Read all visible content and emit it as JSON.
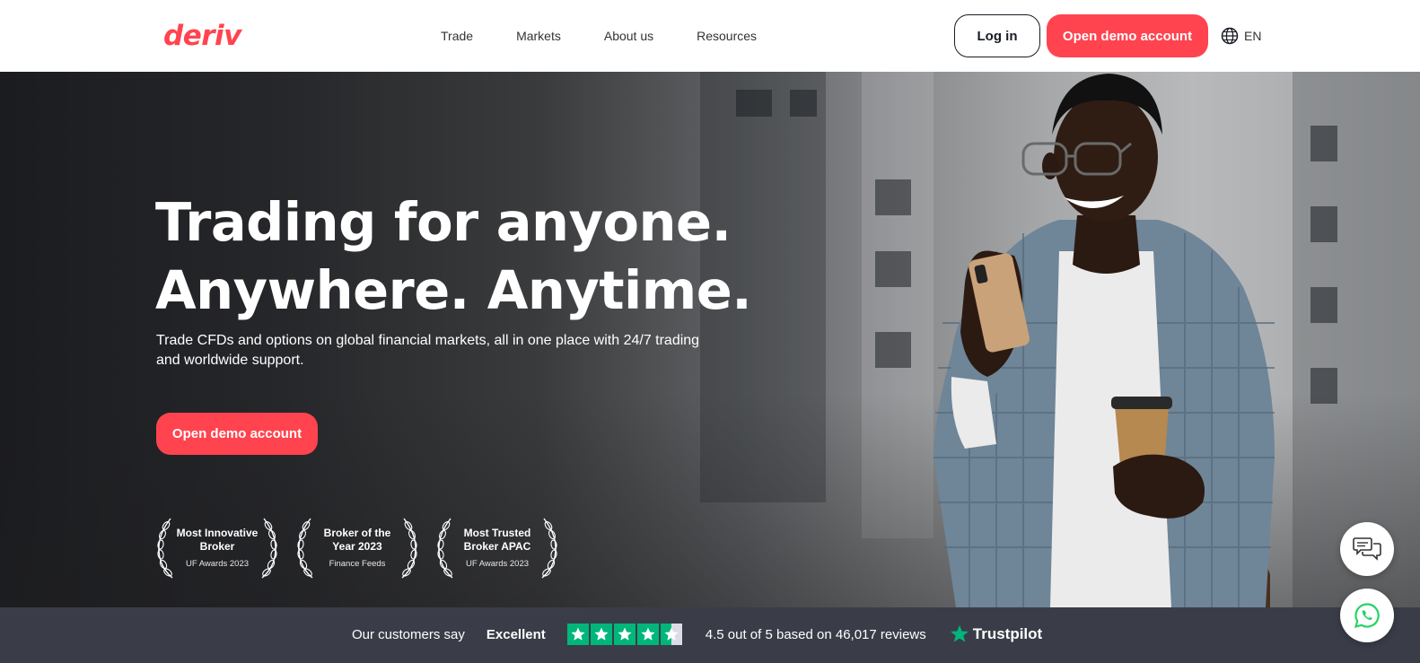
{
  "header": {
    "logo": "deriv",
    "nav": [
      "Trade",
      "Markets",
      "About us",
      "Resources"
    ],
    "login_label": "Log in",
    "demo_label": "Open demo account",
    "language": "EN",
    "language_icon": "globe-icon"
  },
  "hero": {
    "title_line1": "Trading for anyone.",
    "title_line2": "Anywhere. Anytime.",
    "subtitle_line1": "Trade CFDs and options on global financial markets, all in one place with 24/7 trading",
    "subtitle_line2": "and worldwide support.",
    "cta_label": "Open demo account",
    "awards": [
      {
        "title_line1": "Most Innovative",
        "title_line2": "Broker",
        "source": "UF Awards 2023"
      },
      {
        "title_line1": "Broker of the",
        "title_line2": "Year 2023",
        "source": "Finance Feeds"
      },
      {
        "title_line1": "Most Trusted",
        "title_line2": "Broker APAC",
        "source": "UF Awards 2023"
      }
    ]
  },
  "trustpilot": {
    "customers_say": "Our customers say",
    "rating_word": "Excellent",
    "stars_value": 4.5,
    "stars_max": 5,
    "score_text": "4.5 out of 5 based on 46,017 reviews",
    "brand": "Trustpilot"
  },
  "floating": {
    "chat_icon": "chat-bubbles-icon",
    "whatsapp_icon": "whatsapp-icon"
  },
  "colors": {
    "brand_red": "#ff444f",
    "dark": "#181c25",
    "trust_bar": "#3a3d48",
    "trustpilot_green": "#00b67a"
  }
}
